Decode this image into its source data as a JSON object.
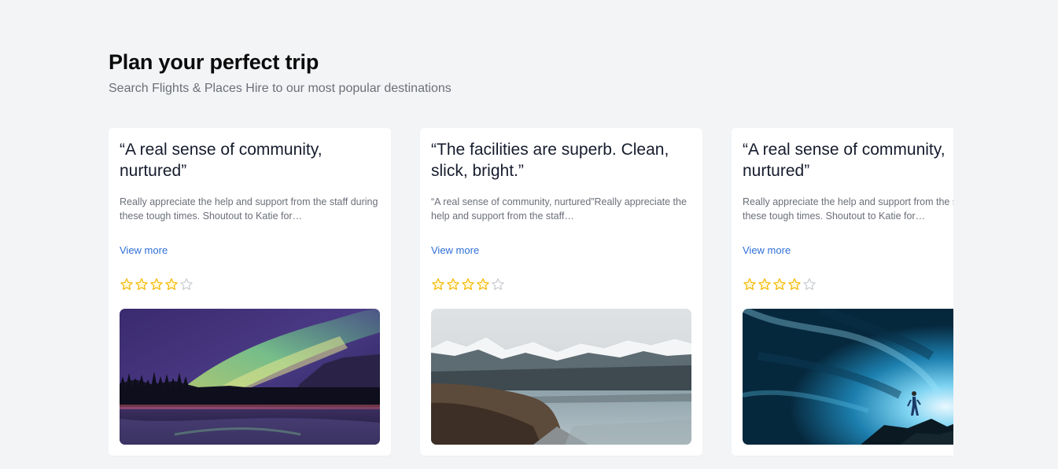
{
  "header": {
    "title": "Plan your perfect trip",
    "subtitle": "Search Flights & Places Hire to our most popular destinations"
  },
  "colors": {
    "background": "#f3f4f6",
    "link": "#2f6fd6",
    "star_filled": "#f5b800",
    "star_empty": "#c8cbd1"
  },
  "testimonials": [
    {
      "quote": "“A real sense of community, nurtured”",
      "body": "Really appreciate the help and support from the staff during these tough times. Shoutout to Katie for…",
      "link": "View more",
      "rating": 4,
      "max_rating": 5,
      "image": "aurora-over-lake-photo"
    },
    {
      "quote": "“The facilities are superb. Clean, slick, bright.”",
      "body": "“A real sense of community, nurtured”Really appreciate the help and support from the staff…",
      "link": "View more",
      "rating": 4,
      "max_rating": 5,
      "image": "mountain-lake-photo"
    },
    {
      "quote": "“A real sense of community, nurtured”",
      "body": "Really appreciate the help and support from the staff during these tough times. Shoutout to Katie for…",
      "link": "View more",
      "rating": 4,
      "max_rating": 5,
      "image": "ice-cave-photo"
    }
  ]
}
